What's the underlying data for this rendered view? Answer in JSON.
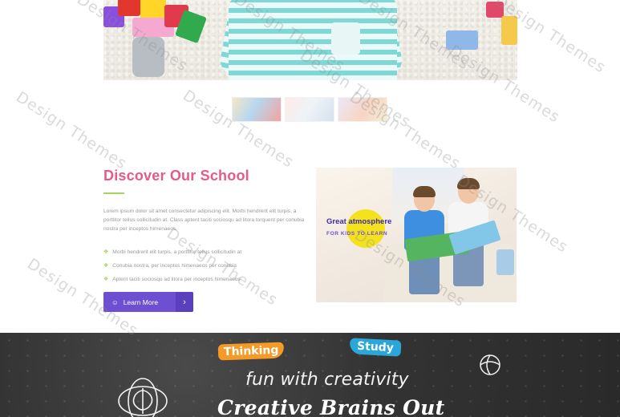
{
  "discover": {
    "title": "Discover Our School",
    "paragraph": "Lorem ipsum dolor sit amet consectetur adipiscing elit. Morbi hendrerit elit turpis, a porttitor tellus sollicitudin at. Class aptent taciti sociosqu ad litora torquent per conubia nostra per inceptos himenaeos.",
    "bullets": [
      "Morbi hendrerit elit turpis, a porttitor tellus sollicitudin at",
      "Conubia nostra, per inceptos himenaeos per conubia",
      "Aptent taciti sociosqu ad litora per inceptos himenaeos"
    ],
    "button_label": "Learn More"
  },
  "kids_image": {
    "line1": "Great atmosphere",
    "line2": "FOR KIDS TO LEARN"
  },
  "chalkboard": {
    "badge_left": "Thinking",
    "badge_right": "Study",
    "subtitle": "fun with creativity",
    "title": "Creative Brains Out"
  },
  "watermark": "Design Themes",
  "colors": {
    "title_pink": "#e65a8a",
    "accent_green": "#a7d35a",
    "button_purple": "#6d4fd2",
    "badge_orange": "#f39a27",
    "badge_blue": "#2aa6d9"
  },
  "icons": {
    "bullet": "leaf-icon",
    "button": "smile-icon",
    "button_arrow": "chevron-right-icon",
    "chalk_left": "brain-icon",
    "chalk_right": "ball-icon"
  }
}
